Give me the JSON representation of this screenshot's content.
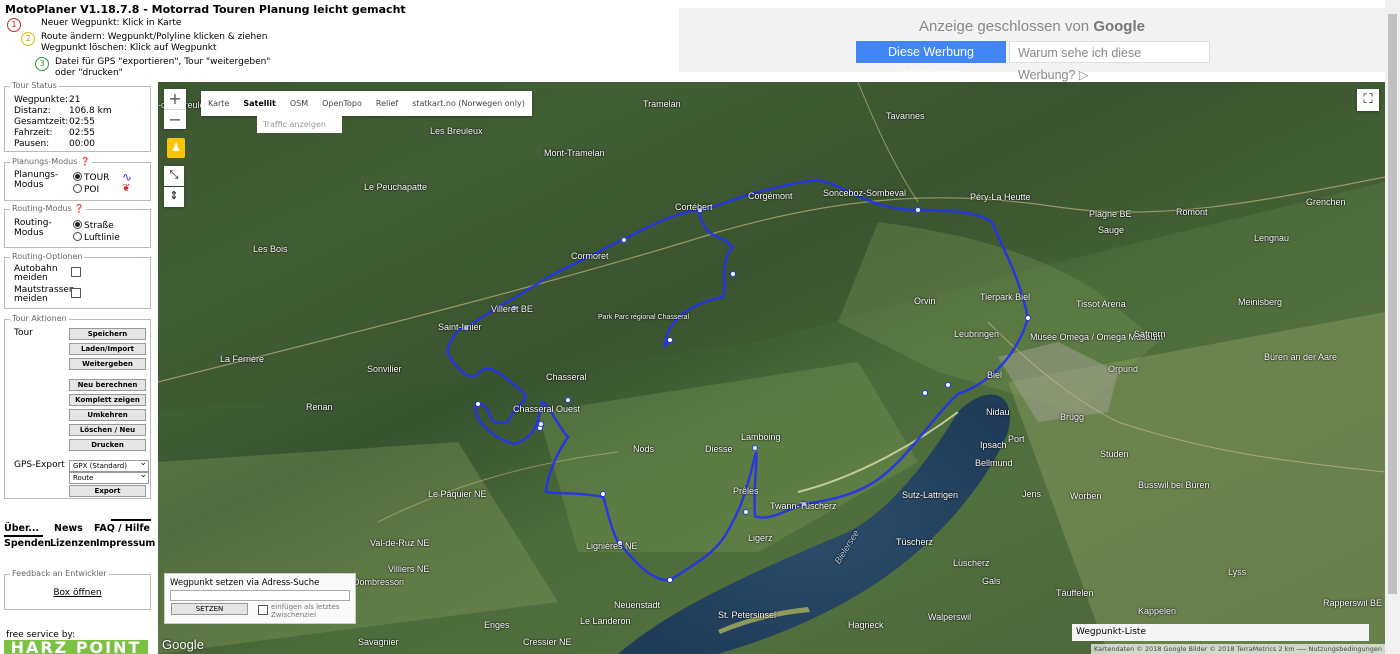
{
  "app": {
    "title": "MotoPlaner V1.18.7.8 - Motorrad Touren Planung leicht gemacht"
  },
  "steps": [
    {
      "num": "1",
      "text": "Neuer Wegpunkt: Klick in Karte",
      "color": "#c62828"
    },
    {
      "num": "2",
      "text": "Route ändern: Wegpunkt/Polyline klicken & ziehen",
      "text2": "Wegpunkt löschen: Klick auf Wegpunkt",
      "color": "#e0c000"
    },
    {
      "num": "3",
      "text": "Datei für GPS \"exportieren\", Tour \"weitergeben\"",
      "text2": "oder \"drucken\"",
      "color": "#2e9e2e"
    }
  ],
  "ad": {
    "title_prefix": "Anzeige geschlossen von",
    "title_brand": "Google",
    "block_button": "Diese Werbung blockieren",
    "why_button": "Warum sehe ich diese Werbung? ▷"
  },
  "tour_status": {
    "legend": "Tour Status",
    "rows": [
      {
        "k": "Wegpunkte:",
        "v": "21"
      },
      {
        "k": "Distanz:",
        "v": "106.8 km"
      },
      {
        "k": "Gesamtzeit:",
        "v": "02:55"
      },
      {
        "k": "Fahrzeit:",
        "v": "02:55"
      },
      {
        "k": "Pausen:",
        "v": "00:00"
      }
    ]
  },
  "planning": {
    "legend": "Planungs-Modus ❓",
    "label": "Planungs-Modus",
    "options": [
      "TOUR",
      "POI"
    ],
    "selected": "TOUR"
  },
  "routing": {
    "legend": "Routing-Modus ❓",
    "label": "Routing-Modus",
    "options": [
      "Straße",
      "Luftlinie"
    ],
    "selected": "Straße"
  },
  "routing_options": {
    "legend": "Routing-Optionen",
    "items": [
      "Autobahn meiden",
      "Mautstrassen meiden"
    ]
  },
  "tour_actions": {
    "legend": "Tour Aktionen",
    "label": "Tour",
    "buttons": [
      "Speichern",
      "Laden/Import",
      "Weitergeben",
      "Neu berechnen",
      "Komplett zeigen",
      "Umkehren",
      "Löschen / Neu",
      "Drucken"
    ],
    "gps_label": "GPS-Export",
    "gps_format": "GPX (Standard)",
    "gps_type": "Route",
    "export_button": "Export"
  },
  "links": [
    "Über...",
    "News",
    "FAQ / Hilfe",
    "Spenden",
    "Lizenzen",
    "Impressum"
  ],
  "feedback": {
    "legend": "Feedback an Entwickler",
    "link": "Box öffnen"
  },
  "footer": {
    "credit": "free service by:",
    "brand": "HARZ POINT"
  },
  "map": {
    "zoom_in": "+",
    "zoom_out": "−",
    "types": [
      "Karte",
      "Satellit",
      "OSM",
      "OpenTopo",
      "Relief",
      "statkart.no (Norwegen only)"
    ],
    "active_type": "Satellit",
    "traffic": "Traffic anzeigen",
    "search_title": "Wegpunkt setzen via Adress-Suche",
    "search_button": "SETZEN",
    "search_checkbox": "einfügen als letztes Zwischenziel",
    "google": "Google",
    "waypoint_list": "Wegpunkt-Liste",
    "attribution": "Kartendaten © 2018 Google Bilder © 2018 TerraMetrics   2 km ⎯⎯⎯   Nutzungsbedingungen",
    "route_color": "#2233ee",
    "labels": [
      "-des-Breuleux",
      "Tramelan",
      "Tavannes",
      "Les Breuleux",
      "Mont-Tramelan",
      "Le Peuchapatte",
      "Corgémont",
      "Sonceboz-Sombeval",
      "Péry-La Heutte",
      "Grenchen",
      "Cortébert",
      "Plagne BE",
      "Sauge",
      "Romont",
      "Lengnau",
      "Les Bois",
      "Cormoret",
      "Orvin",
      "Tierpark Biel",
      "Tissot Arena",
      "Meinisberg",
      "Villeret BE",
      "Saint-Imier",
      "Park Parc régional Chasseral",
      "Leubringen",
      "Musée Omega / Omega Museum",
      "Safnern",
      "Büren an der Aare",
      "La Ferrière",
      "Sonvilier",
      "Chasseral",
      "Biel",
      "Orpund",
      "Renan",
      "Chasseral Ouest",
      "Nidau",
      "Brügg",
      "Nods",
      "Diesse",
      "Lamboing",
      "Ipsach",
      "Port",
      "Studen",
      "Bellmund",
      "Prêles",
      "Twann-Tüscherz",
      "Sutz-Lattrigen",
      "Jens",
      "Worben",
      "Busswil bei Büren",
      "Le Pâquier NE",
      "Ligerz",
      "Lignières NE",
      "Val-de-Ruz NE",
      "Villiers NE",
      "Dombresson",
      "Neuenstadt",
      "Gals",
      "Tüscherz",
      "Lüscherz",
      "Lyss",
      "Täuffelen",
      "Kappelen",
      "Rapperswil BE",
      "Enges",
      "Cressier NE",
      "Savagnier",
      "St. Petersinsel",
      "Le Landeron",
      "Hagneck",
      "Walperswil",
      "Bielersee"
    ]
  }
}
